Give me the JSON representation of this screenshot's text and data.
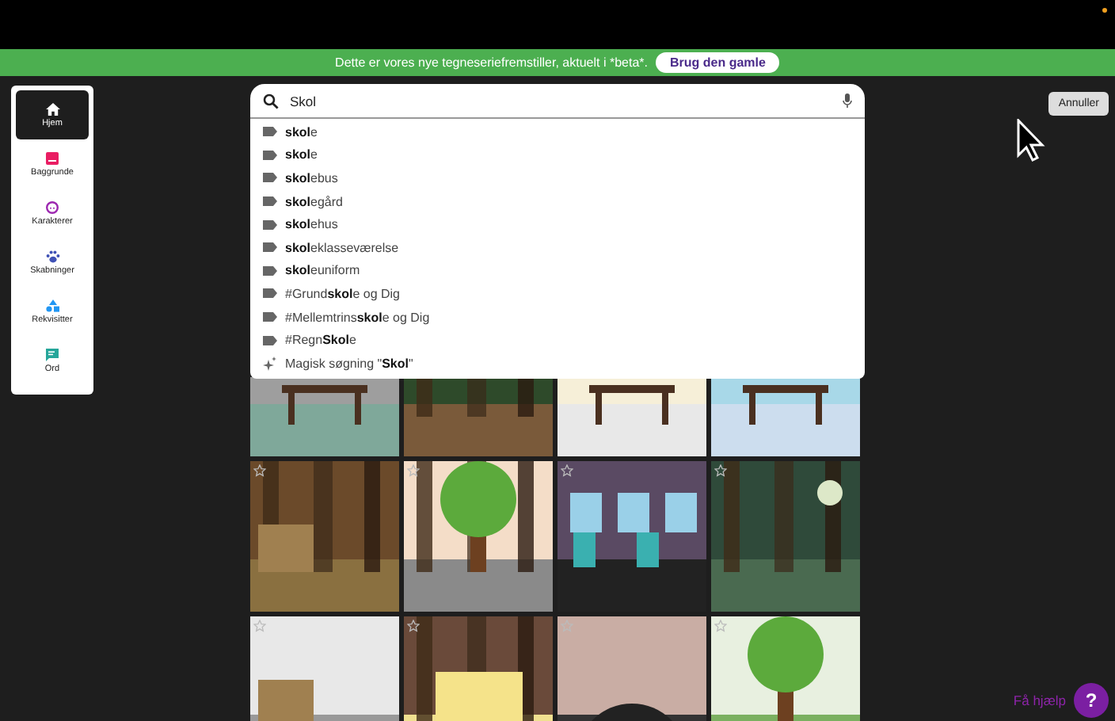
{
  "banner": {
    "message": "Dette er vores nye tegneseriefremstiller, aktuelt i *beta*.",
    "button": "Brug den gamle"
  },
  "sidebar": {
    "items": [
      {
        "label": "Hjem",
        "selected": true
      },
      {
        "label": "Baggrunde",
        "selected": false
      },
      {
        "label": "Karakterer",
        "selected": false
      },
      {
        "label": "Skabninger",
        "selected": false
      },
      {
        "label": "Rekvisitter",
        "selected": false
      },
      {
        "label": "Ord",
        "selected": false
      }
    ]
  },
  "search": {
    "value": "Skol"
  },
  "suggestions": [
    {
      "kind": "tag",
      "text": "**skol**e"
    },
    {
      "kind": "tag",
      "text": "**skol**e"
    },
    {
      "kind": "tag",
      "text": "**skol**ebus"
    },
    {
      "kind": "tag",
      "text": "**skol**egård"
    },
    {
      "kind": "tag",
      "text": "**skol**ehus"
    },
    {
      "kind": "tag",
      "text": "**skol**eklasseværelse"
    },
    {
      "kind": "tag",
      "text": "**skol**euniform"
    },
    {
      "kind": "tag",
      "text": "#Grund**skol**e og Dig"
    },
    {
      "kind": "tag",
      "text": "#Mellemtrins**skol**e og Dig"
    },
    {
      "kind": "tag",
      "text": "#Regn**Skol**e"
    },
    {
      "kind": "magic",
      "text": "Magisk søgning \"**Skol**\""
    }
  ],
  "tiles": [
    {
      "kind": "picture",
      "favorite_icon": false
    },
    {
      "kind": "picture",
      "favorite_icon": false
    },
    {
      "kind": "picture",
      "favorite_icon": false
    },
    {
      "kind": "picture",
      "favorite_icon": false
    },
    {
      "kind": "picture",
      "favorite_icon": true
    },
    {
      "kind": "picture",
      "favorite_icon": true
    },
    {
      "kind": "picture",
      "favorite_icon": true
    },
    {
      "kind": "picture",
      "favorite_icon": true
    },
    {
      "kind": "picture",
      "favorite_icon": true
    },
    {
      "kind": "picture",
      "favorite_icon": true
    },
    {
      "kind": "picture",
      "favorite_icon": true
    },
    {
      "kind": "picture",
      "favorite_icon": true
    }
  ],
  "cancel_button": "Annuller",
  "help": {
    "label": "Få hjælp",
    "button": "?"
  }
}
